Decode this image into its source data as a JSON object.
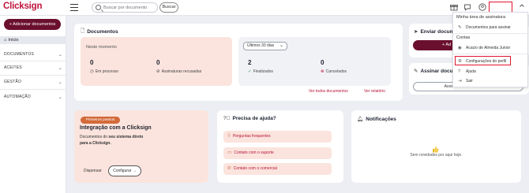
{
  "app": {
    "logo": "Clicksign"
  },
  "topbar": {
    "search_placeholder": "Buscar por documento",
    "search_button": "Buscar"
  },
  "user_menu": {
    "section_signature": "Minha área de assinatura",
    "documents_to_sign": "Documentos para assinar",
    "section_accounts": "Contas",
    "account_name": "Acacio de Almeida Junior",
    "profile_settings": "Configurações do perfil",
    "help": "Ajuda",
    "logout": "Sair"
  },
  "sidebar": {
    "add_documents": "+ Adicionar documentos",
    "home": "Início",
    "sections": [
      {
        "label": "DOCUMENTOS"
      },
      {
        "label": "ACEITES"
      },
      {
        "label": "GESTÃO"
      },
      {
        "label": "AUTOMAÇÃO"
      }
    ]
  },
  "documents_card": {
    "title": "Documentos",
    "current_label": "Neste momento",
    "in_process_value": "0",
    "in_process_label": "Em processo",
    "refused_value": "0",
    "refused_label": "Assinaturas recusadas",
    "period": "Últimos 30 dias",
    "finished_value": "2",
    "finished_label": "Finalizados",
    "cancelled_value": "0",
    "cancelled_label": "Cancelados",
    "view_all": "Ver todos documentos",
    "view_report": "Ver relatório"
  },
  "send_card": {
    "title": "Enviar docume",
    "button": "+ Ad"
  },
  "sign_card": {
    "title": "Assinar docu",
    "button": "Acessar área de assinatura"
  },
  "onboarding_card": {
    "badge": "Primeiros passos",
    "title": "Integração com a Clicksign",
    "text_1": "Documentos do ",
    "text_bold": "seu sistema direto para a Clicksign.",
    "dismiss": "Dispensar",
    "configure": "Configurar →"
  },
  "help_card": {
    "title": "Precisa de ajuda?",
    "items": [
      {
        "label": "Perguntas frequentes"
      },
      {
        "label": "Contato com o suporte"
      },
      {
        "label": "Contato com o comercial"
      }
    ]
  },
  "notifications_card": {
    "title": "Notificações",
    "empty": "Sem novidades por aqui hoje."
  },
  "colors": {
    "brand": "#c0143c",
    "maroon": "#6b0f2e",
    "highlight": "#e0142e"
  }
}
